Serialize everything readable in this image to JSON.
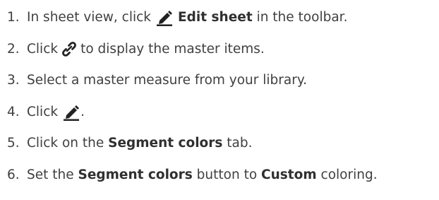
{
  "steps": [
    {
      "number": "1.",
      "parts": {
        "a": "In sheet view, click",
        "icon": "pencil-icon",
        "b": "Edit sheet",
        "c": "in the toolbar."
      }
    },
    {
      "number": "2.",
      "parts": {
        "a": "Click",
        "icon": "link-icon",
        "c": "to display the master items."
      }
    },
    {
      "number": "3.",
      "parts": {
        "a": "Select a master measure from your library."
      }
    },
    {
      "number": "4.",
      "parts": {
        "a": "Click",
        "icon": "pencil-icon",
        "c": "."
      }
    },
    {
      "number": "5.",
      "parts": {
        "a": "Click on the",
        "b": "Segment colors",
        "c": "tab."
      }
    },
    {
      "number": "6.",
      "parts": {
        "a": "Set the",
        "b": "Segment colors",
        "c": "button to",
        "d": "Custom",
        "e": "coloring."
      }
    }
  ],
  "colors": {
    "text": "#404040",
    "icon": "#222222"
  }
}
